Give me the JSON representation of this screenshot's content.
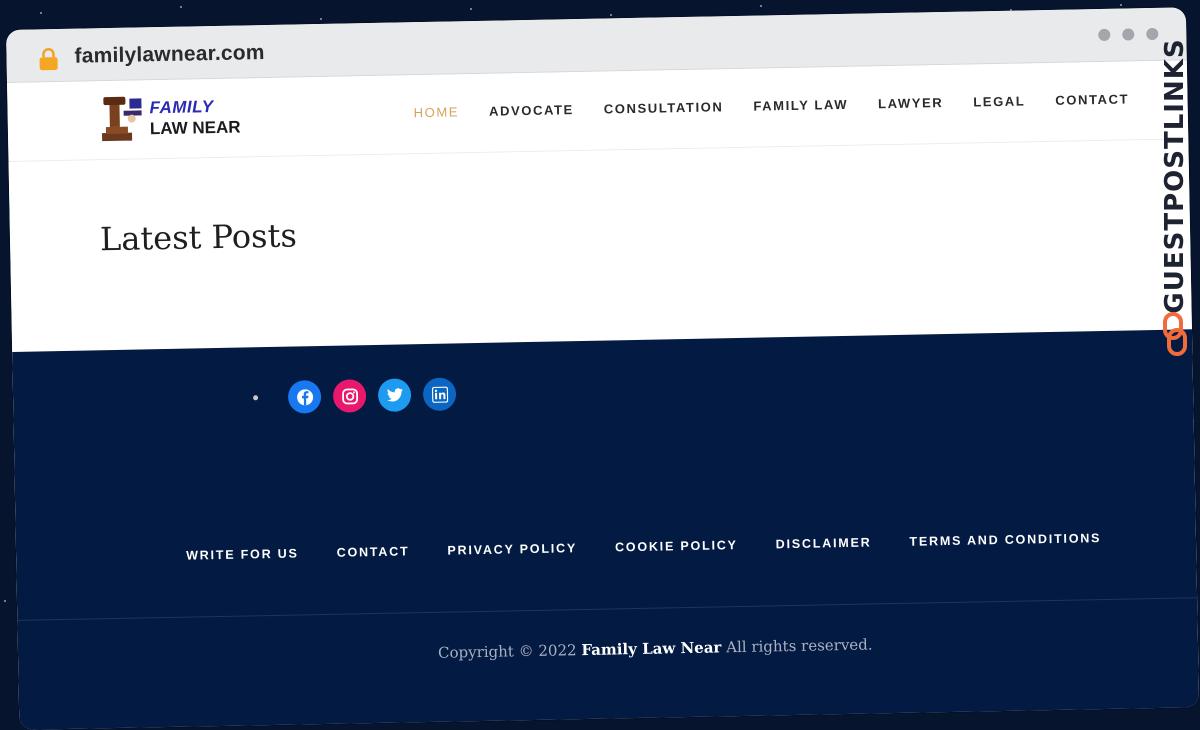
{
  "browser": {
    "url": "familylawnear.com"
  },
  "header": {
    "logo_line1": "FAMILY",
    "logo_line2": "LAW NEAR",
    "nav": [
      {
        "label": "HOME",
        "active": true
      },
      {
        "label": "ADVOCATE"
      },
      {
        "label": "CONSULTATION"
      },
      {
        "label": "FAMILY LAW"
      },
      {
        "label": "LAWYER"
      },
      {
        "label": "LEGAL"
      },
      {
        "label": "CONTACT"
      }
    ]
  },
  "main": {
    "title": "Latest Posts"
  },
  "footer": {
    "social": [
      "facebook-icon",
      "instagram-icon",
      "twitter-icon",
      "linkedin-icon"
    ],
    "links": [
      {
        "label": "WRITE FOR US"
      },
      {
        "label": "CONTACT"
      },
      {
        "label": "PRIVACY POLICY"
      },
      {
        "label": "COOKIE POLICY"
      },
      {
        "label": "DISCLAIMER"
      },
      {
        "label": "TERMS AND CONDITIONS"
      }
    ],
    "copyright_prefix": "Copyright © 2022",
    "copyright_brand": "Family Law Near",
    "copyright_suffix": "All rights reserved."
  },
  "watermark": {
    "text": "GUESTPOSTLINKS"
  },
  "colors": {
    "accent": "#d9a35b",
    "footer_bg": "#031a42",
    "watermark_icon": "#f26b3a"
  }
}
